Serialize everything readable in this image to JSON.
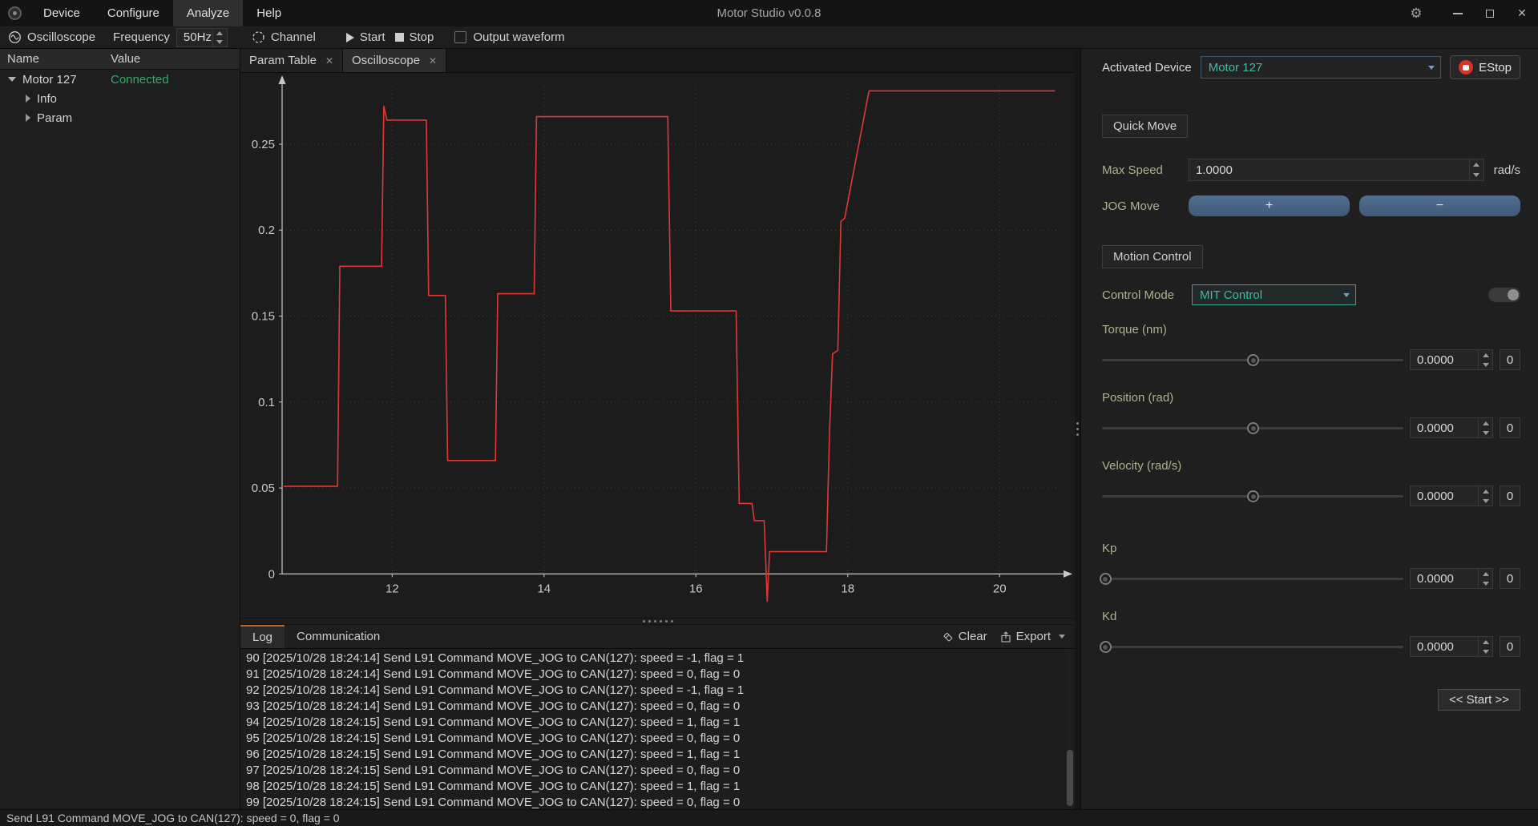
{
  "titlebar": {
    "title": "Motor Studio v0.0.8",
    "menus": [
      {
        "label": "Device"
      },
      {
        "label": "Configure"
      },
      {
        "label": "Analyze"
      },
      {
        "label": "Help"
      }
    ]
  },
  "toolbar": {
    "oscilloscope_label": "Oscilloscope",
    "frequency_label": "Frequency",
    "frequency_value": "50Hz",
    "channel_label": "Channel",
    "start_label": "Start",
    "stop_label": "Stop",
    "output_waveform_label": "Output waveform",
    "output_waveform_checked": false
  },
  "tree": {
    "name_header": "Name",
    "value_header": "Value",
    "rows": [
      {
        "label": "Motor 127",
        "value": "Connected",
        "level": 0,
        "expanded": true
      },
      {
        "label": "Info",
        "value": "",
        "level": 1,
        "expanded": false
      },
      {
        "label": "Param",
        "value": "",
        "level": 1,
        "expanded": false
      }
    ]
  },
  "center_tabs": [
    {
      "label": "Param Table"
    },
    {
      "label": "Oscilloscope",
      "active": true
    }
  ],
  "chart_data": {
    "type": "line",
    "title": "",
    "xlabel": "",
    "ylabel": "",
    "xlim": [
      10.55,
      20.8
    ],
    "ylim": [
      -0.018,
      0.284
    ],
    "xticks": [
      12,
      14,
      16,
      18,
      20
    ],
    "ytick_values": [
      0,
      0.05,
      0.1,
      0.15,
      0.2,
      0.25
    ],
    "ytick_labels": [
      "0",
      "0.05",
      "0.1",
      "0.15",
      "0.2",
      "0.25"
    ],
    "grid": "dotted",
    "legend": "none",
    "axis_color": "#c8c8c8",
    "grid_color": "#3c3c3c",
    "series": [
      {
        "name": "oscilloscope-trace",
        "color": "#dc3a34",
        "points": [
          [
            10.57,
            0.051
          ],
          [
            11.28,
            0.051
          ],
          [
            11.31,
            0.179
          ],
          [
            11.86,
            0.179
          ],
          [
            11.89,
            0.272
          ],
          [
            11.93,
            0.264
          ],
          [
            12.45,
            0.264
          ],
          [
            12.48,
            0.162
          ],
          [
            12.7,
            0.162
          ],
          [
            12.73,
            0.066
          ],
          [
            13.36,
            0.066
          ],
          [
            13.39,
            0.163
          ],
          [
            13.87,
            0.163
          ],
          [
            13.9,
            0.266
          ],
          [
            15.63,
            0.266
          ],
          [
            15.67,
            0.153
          ],
          [
            16.53,
            0.153
          ],
          [
            16.57,
            0.041
          ],
          [
            16.74,
            0.041
          ],
          [
            16.77,
            0.031
          ],
          [
            16.9,
            0.031
          ],
          [
            16.94,
            -0.016
          ],
          [
            16.97,
            0.013
          ],
          [
            17.72,
            0.013
          ],
          [
            17.76,
            0.082
          ],
          [
            17.8,
            0.128
          ],
          [
            17.87,
            0.13
          ],
          [
            17.91,
            0.205
          ],
          [
            17.96,
            0.207
          ],
          [
            18.28,
            0.281
          ],
          [
            20.73,
            0.281
          ]
        ]
      }
    ]
  },
  "log": {
    "tabs": [
      {
        "label": "Log",
        "active": true
      },
      {
        "label": "Communication"
      }
    ],
    "clear_label": "Clear",
    "export_label": "Export",
    "lines": [
      "90 [2025/10/28 18:24:14] Send L91 Command MOVE_JOG to CAN(127): speed = -1, flag = 1",
      "91 [2025/10/28 18:24:14] Send L91 Command MOVE_JOG to CAN(127): speed = 0, flag = 0",
      "92 [2025/10/28 18:24:14] Send L91 Command MOVE_JOG to CAN(127): speed = -1, flag = 1",
      "93 [2025/10/28 18:24:14] Send L91 Command MOVE_JOG to CAN(127): speed = 0, flag = 0",
      "94 [2025/10/28 18:24:15] Send L91 Command MOVE_JOG to CAN(127): speed = 1, flag = 1",
      "95 [2025/10/28 18:24:15] Send L91 Command MOVE_JOG to CAN(127): speed = 0, flag = 0",
      "96 [2025/10/28 18:24:15] Send L91 Command MOVE_JOG to CAN(127): speed = 1, flag = 1",
      "97 [2025/10/28 18:24:15] Send L91 Command MOVE_JOG to CAN(127): speed = 0, flag = 0",
      "98 [2025/10/28 18:24:15] Send L91 Command MOVE_JOG to CAN(127): speed = 1, flag = 1",
      "99 [2025/10/28 18:24:15] Send L91 Command MOVE_JOG to CAN(127): speed = 0, flag = 0"
    ]
  },
  "right_panel": {
    "activated_device_label": "Activated Device",
    "activated_device_value": "Motor 127",
    "estop_label": "EStop",
    "quick_move": {
      "title": "Quick Move",
      "max_speed_label": "Max Speed",
      "max_speed_value": "1.0000",
      "max_speed_unit": "rad/s",
      "jog_move_label": "JOG Move",
      "jog_plus_label": "+",
      "jog_minus_label": "−"
    },
    "motion_control": {
      "title": "Motion Control",
      "control_mode_label": "Control Mode",
      "control_mode_value": "MIT Control",
      "toggle_on": false,
      "sliders": [
        {
          "label": "Torque (nm)",
          "value": "0.0000",
          "extra_value": "0",
          "pos": 50
        },
        {
          "label": "Position (rad)",
          "value": "0.0000",
          "extra_value": "0",
          "pos": 50
        },
        {
          "label": "Velocity (rad/s)",
          "value": "0.0000",
          "extra_value": "0",
          "pos": 50
        },
        {
          "label": "Kp",
          "value": "0.0000",
          "extra_value": "0",
          "pos": 1
        },
        {
          "label": "Kd",
          "value": "0.0000",
          "extra_value": "0",
          "pos": 1
        }
      ],
      "start_button_label": "<< Start >>"
    }
  },
  "statusbar": {
    "text": "Send L91 Command MOVE_JOG to CAN(127): speed = 0, flag = 0"
  },
  "colors": {
    "accent_teal": "#45b8a5",
    "connected_green": "#2eaf64",
    "trace_red": "#dc3a34",
    "jog_button_blue": "#47627f",
    "estop_red": "#d43425",
    "log_tab_accent": "#b06a35"
  }
}
